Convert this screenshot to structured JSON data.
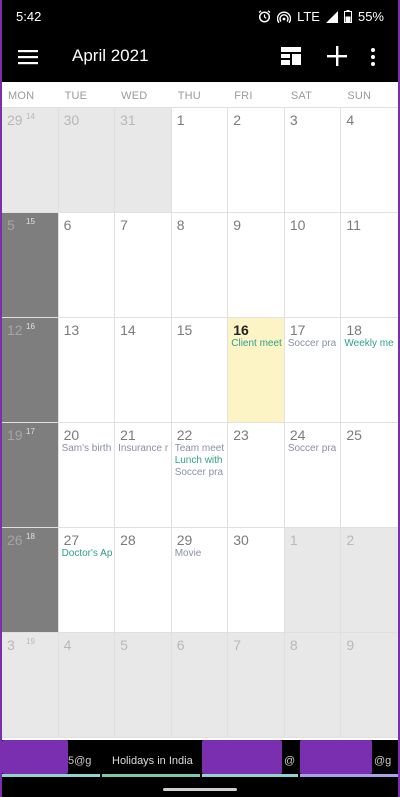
{
  "status": {
    "time": "5:42",
    "network": "LTE",
    "battery": "55%"
  },
  "app": {
    "title": "April 2021"
  },
  "weekdays": [
    "MON",
    "TUE",
    "WED",
    "THU",
    "FRI",
    "SAT",
    "SUN"
  ],
  "weeks": [
    {
      "week_number": "14",
      "days": [
        {
          "num": "29",
          "other": true
        },
        {
          "num": "30",
          "other": true
        },
        {
          "num": "31",
          "other": true
        },
        {
          "num": "1"
        },
        {
          "num": "2"
        },
        {
          "num": "3"
        },
        {
          "num": "4"
        }
      ]
    },
    {
      "week_number": "15",
      "days": [
        {
          "num": "5",
          "weeknum_col": true
        },
        {
          "num": "6"
        },
        {
          "num": "7"
        },
        {
          "num": "8"
        },
        {
          "num": "9"
        },
        {
          "num": "10"
        },
        {
          "num": "11"
        }
      ]
    },
    {
      "week_number": "16",
      "days": [
        {
          "num": "12",
          "weeknum_col": true
        },
        {
          "num": "13"
        },
        {
          "num": "14"
        },
        {
          "num": "15"
        },
        {
          "num": "16",
          "today": true,
          "events": [
            {
              "text": "Client meet",
              "color": "teal"
            }
          ]
        },
        {
          "num": "17",
          "events": [
            {
              "text": "Soccer pra",
              "color": "gray"
            }
          ]
        },
        {
          "num": "18",
          "events": [
            {
              "text": "Weekly me",
              "color": "teal"
            }
          ]
        }
      ]
    },
    {
      "week_number": "17",
      "days": [
        {
          "num": "19",
          "weeknum_col": true
        },
        {
          "num": "20",
          "events": [
            {
              "text": "Sam's birth",
              "color": "gray"
            }
          ]
        },
        {
          "num": "21",
          "events": [
            {
              "text": "Insurance r",
              "color": "gray"
            }
          ]
        },
        {
          "num": "22",
          "events": [
            {
              "text": "Team meet",
              "color": "gray"
            },
            {
              "text": "Lunch with",
              "color": "teal"
            },
            {
              "text": "Soccer pra",
              "color": "gray"
            }
          ]
        },
        {
          "num": "23"
        },
        {
          "num": "24",
          "events": [
            {
              "text": "Soccer pra",
              "color": "gray"
            }
          ]
        },
        {
          "num": "25"
        }
      ]
    },
    {
      "week_number": "18",
      "days": [
        {
          "num": "26",
          "weeknum_col": true
        },
        {
          "num": "27",
          "events": [
            {
              "text": "Doctor's Ap",
              "color": "teal"
            }
          ]
        },
        {
          "num": "28"
        },
        {
          "num": "29",
          "events": [
            {
              "text": "Movie",
              "color": "gray"
            }
          ]
        },
        {
          "num": "30"
        },
        {
          "num": "1",
          "other": true
        },
        {
          "num": "2",
          "other": true
        }
      ]
    },
    {
      "week_number": "19",
      "days": [
        {
          "num": "3",
          "other": true
        },
        {
          "num": "4",
          "other": true
        },
        {
          "num": "5",
          "other": true
        },
        {
          "num": "6",
          "other": true
        },
        {
          "num": "7",
          "other": true
        },
        {
          "num": "8",
          "other": true
        },
        {
          "num": "9",
          "other": true
        }
      ]
    }
  ],
  "bottom": {
    "account1_suffix": "5@g",
    "holidays": "Holidays in India",
    "account3_suffix": "@",
    "account4_suffix": "@g"
  },
  "colors": {
    "event_teal": "#2f9f8e",
    "event_gray": "#8a8fa6",
    "today": "#fcf4c4",
    "accent_purple": "#7a2fb0",
    "underline_teal": "#8fd6cf",
    "underline_lavender": "#a8a0ea"
  }
}
